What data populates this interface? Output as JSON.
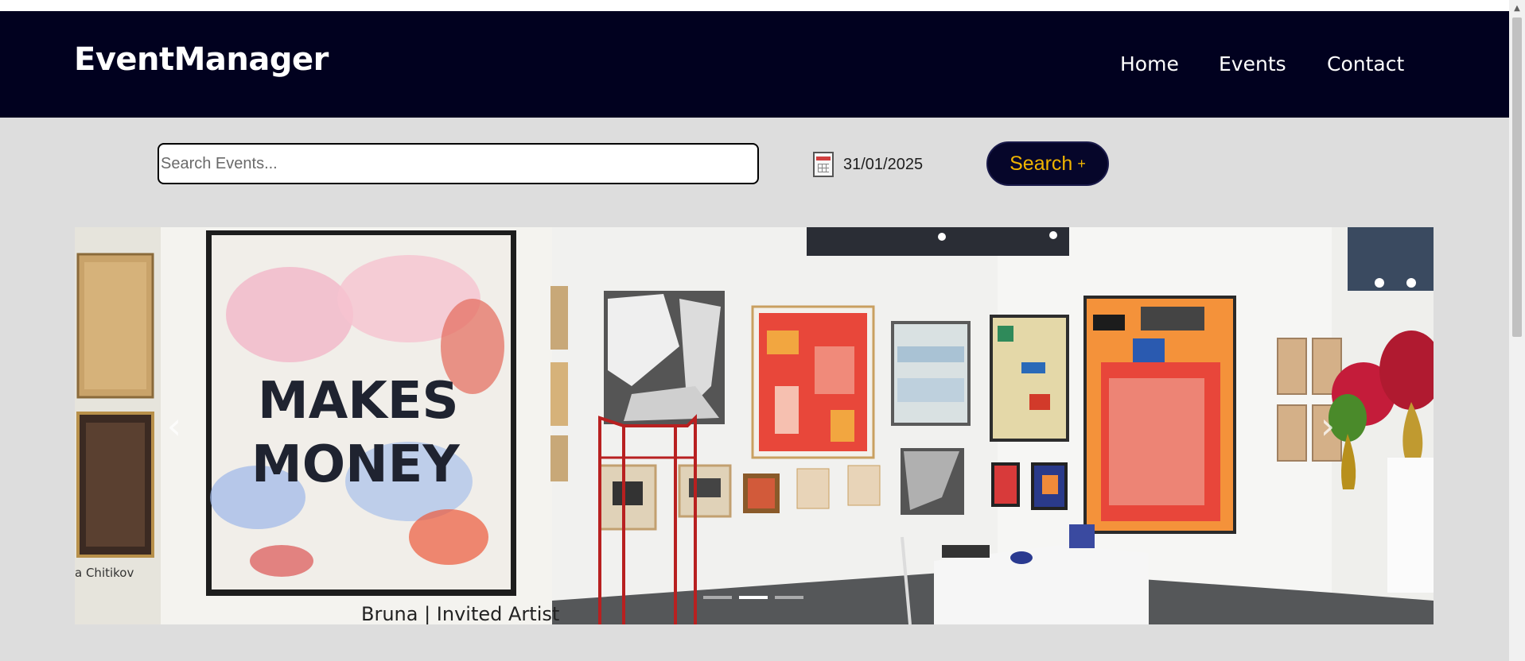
{
  "header": {
    "brand": "EventManager",
    "nav": [
      {
        "label": "Home"
      },
      {
        "label": "Events"
      },
      {
        "label": "Contact"
      }
    ]
  },
  "search": {
    "placeholder": "Search Events...",
    "value": "",
    "date": "31/01/2025",
    "button_label": "Search",
    "button_icon": "+"
  },
  "carousel": {
    "slide_count": 3,
    "active_slide": 2,
    "prev_icon": "‹",
    "next_icon": "›",
    "image_text": {
      "artwork_line1": "MAKES",
      "artwork_line2": "MONEY",
      "caption_left": "a Chitikov",
      "caption_bottom": "Bruna | Invited Artist"
    }
  },
  "colors": {
    "navbar_bg": "#01011f",
    "page_bg": "#dddddd",
    "button_bg": "#06062a",
    "button_text": "#f0b400"
  }
}
